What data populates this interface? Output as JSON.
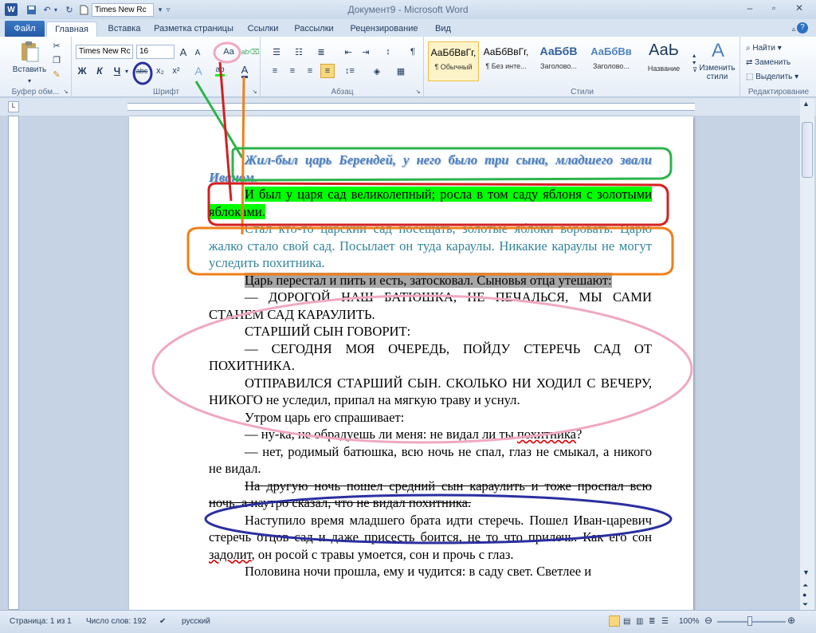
{
  "titlebar": {
    "title": "Документ9 - Microsoft Word",
    "qat_font": "Times New Rc",
    "icons": [
      "word-icon",
      "save-icon",
      "undo-icon",
      "redo-icon",
      "new-doc-icon",
      "qat-dropdown-icon"
    ]
  },
  "tabs": {
    "file": "Файл",
    "items": [
      "Главная",
      "Вставка",
      "Разметка страницы",
      "Ссылки",
      "Рассылки",
      "Рецензирование",
      "Вид"
    ]
  },
  "ribbon": {
    "clipboard": {
      "paste": "Вставить",
      "label": "Буфер обм..."
    },
    "font": {
      "name": "Times New Rc",
      "size": "16",
      "label": "Шрифт",
      "bold": "Ж",
      "italic": "К",
      "underline": "Ч",
      "strike": "abc",
      "sub": "x₂",
      "sup": "x²",
      "grow": "A",
      "shrink": "A",
      "case": "Aa"
    },
    "paragraph": {
      "label": "Абзац"
    },
    "styles": {
      "label": "Стили",
      "items": [
        {
          "preview": "АаБбВвГг,",
          "name": "¶ Обычный"
        },
        {
          "preview": "АаБбВвГг,",
          "name": "¶ Без инте..."
        },
        {
          "preview": "АаБбВ",
          "name": "Заголово..."
        },
        {
          "preview": "АаБбВв",
          "name": "Заголово..."
        },
        {
          "preview": "АаЬ",
          "name": "Название"
        }
      ],
      "change": "Изменить стили"
    },
    "editing": {
      "label": "Редактирование",
      "find": "Найти",
      "replace": "Заменить",
      "select": "Выделить"
    }
  },
  "document": {
    "p1": "Жил-был царь Берендей, у него было три сына, младшего звали Иваном.",
    "p2": "И был у царя сад великолепный; росла в том саду яблоня с золотыми яблоками.",
    "p3": "Стал кто-то царский сад посещать, золотые яблоки воровать. Царю жалко стало свой сад. Посылает он туда караулы. Никакие караулы не могут уследить похитника.",
    "p4": "Царь перестал и пить и есть, затосковал. Сыновья отца утешают:",
    "p5": "— Дорогой наш батюшка, не печалься, мы сами станем сад караулить.",
    "p6": "Старший сын говорит:",
    "p7": "— Сегодня моя очередь, пойду стеречь сад от похитника.",
    "p8a": "Отправился старший сын. Сколько ни ходил с вечеру, никого",
    "p8b": " не уследил, припал на мягкую траву и уснул.",
    "p9": "Утром царь его спрашивает:",
    "p10a": "— ну-ка, не обрадуешь ли меня: не видал ли ты ",
    "p10b": "похитника",
    "p10c": "?",
    "p11": "— нет, родимый батюшка, всю ночь не спал, глаз не смыкал, а никого не видал.",
    "p12": "На другую ночь пошел средний сын караулить и тоже проспал всю ночь, а наутро сказал, что не видал похитника.",
    "p13a": "Наступило время младшего брата идти стеречь. Пошел Иван-царевич стеречь отцов сад и даже присесть боится, не то что прилечь. Как его сон ",
    "p13b": "задолит",
    "p13c": ", он росой с травы умоется, сон и прочь с глаз.",
    "p14": "Половина ночи прошла, ему и чудится: в саду свет. Светлее и"
  },
  "status": {
    "page": "Страница: 1 из 1",
    "words": "Число слов: 192",
    "lang": "русский",
    "zoom": "100%"
  },
  "annotation_colors": {
    "green": "#2db34a",
    "red": "#d42020",
    "orange": "#f07f19",
    "pink": "#f0a8c0",
    "blue": "#2a2fa0"
  }
}
